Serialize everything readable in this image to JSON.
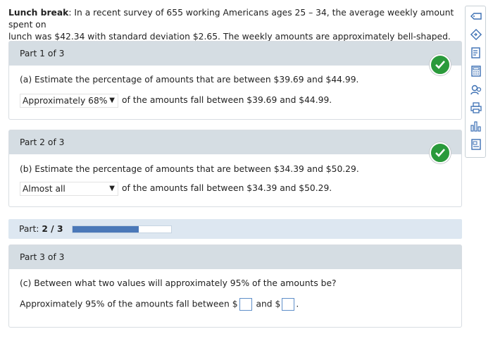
{
  "problem": {
    "bold_label": "Lunch break",
    "text_line1": ": In a recent survey of 655 working Americans ages 25 – 34, the average weekly amount spent on",
    "text_line2": "lunch was $42.34 with standard deviation $2.65. The weekly amounts are approximately bell-shaped."
  },
  "part1": {
    "header": "Part 1 of 3",
    "question": "(a) Estimate the percentage of amounts that are between $39.69 and $44.99.",
    "selected": "Approximately 68%",
    "after_text": "of the amounts fall between $39.69 and $44.99.",
    "status": "correct"
  },
  "part2": {
    "header": "Part 2 of 3",
    "question": "(b) Estimate the percentage of amounts that are between $34.39 and $50.29.",
    "selected": "Almost all",
    "after_text": "of the amounts fall between $34.39 and $50.29.",
    "status": "correct"
  },
  "progress": {
    "label": "Part:",
    "value_text": "2 / 3",
    "fraction": 0.67
  },
  "part3": {
    "header": "Part 3 of 3",
    "question": "(c) Between what two values will approximately 95% of the amounts be?",
    "answer_prefix": "Approximately 95% of the amounts fall between",
    "dollar1": "$",
    "and_text": "and",
    "dollar2": "$",
    "end": ".",
    "input1_value": "",
    "input2_value": ""
  },
  "toolbar": {
    "icons": [
      "eraser-icon",
      "tag-icon",
      "notebook-icon",
      "calculator-icon",
      "tutor-icon",
      "print-icon",
      "chart-icon",
      "document-icon"
    ]
  },
  "colors": {
    "header_bg": "#d5dde3",
    "check_green": "#2a9a3b",
    "progress_fill": "#4a78b8",
    "input_border": "#5f8fc9"
  }
}
